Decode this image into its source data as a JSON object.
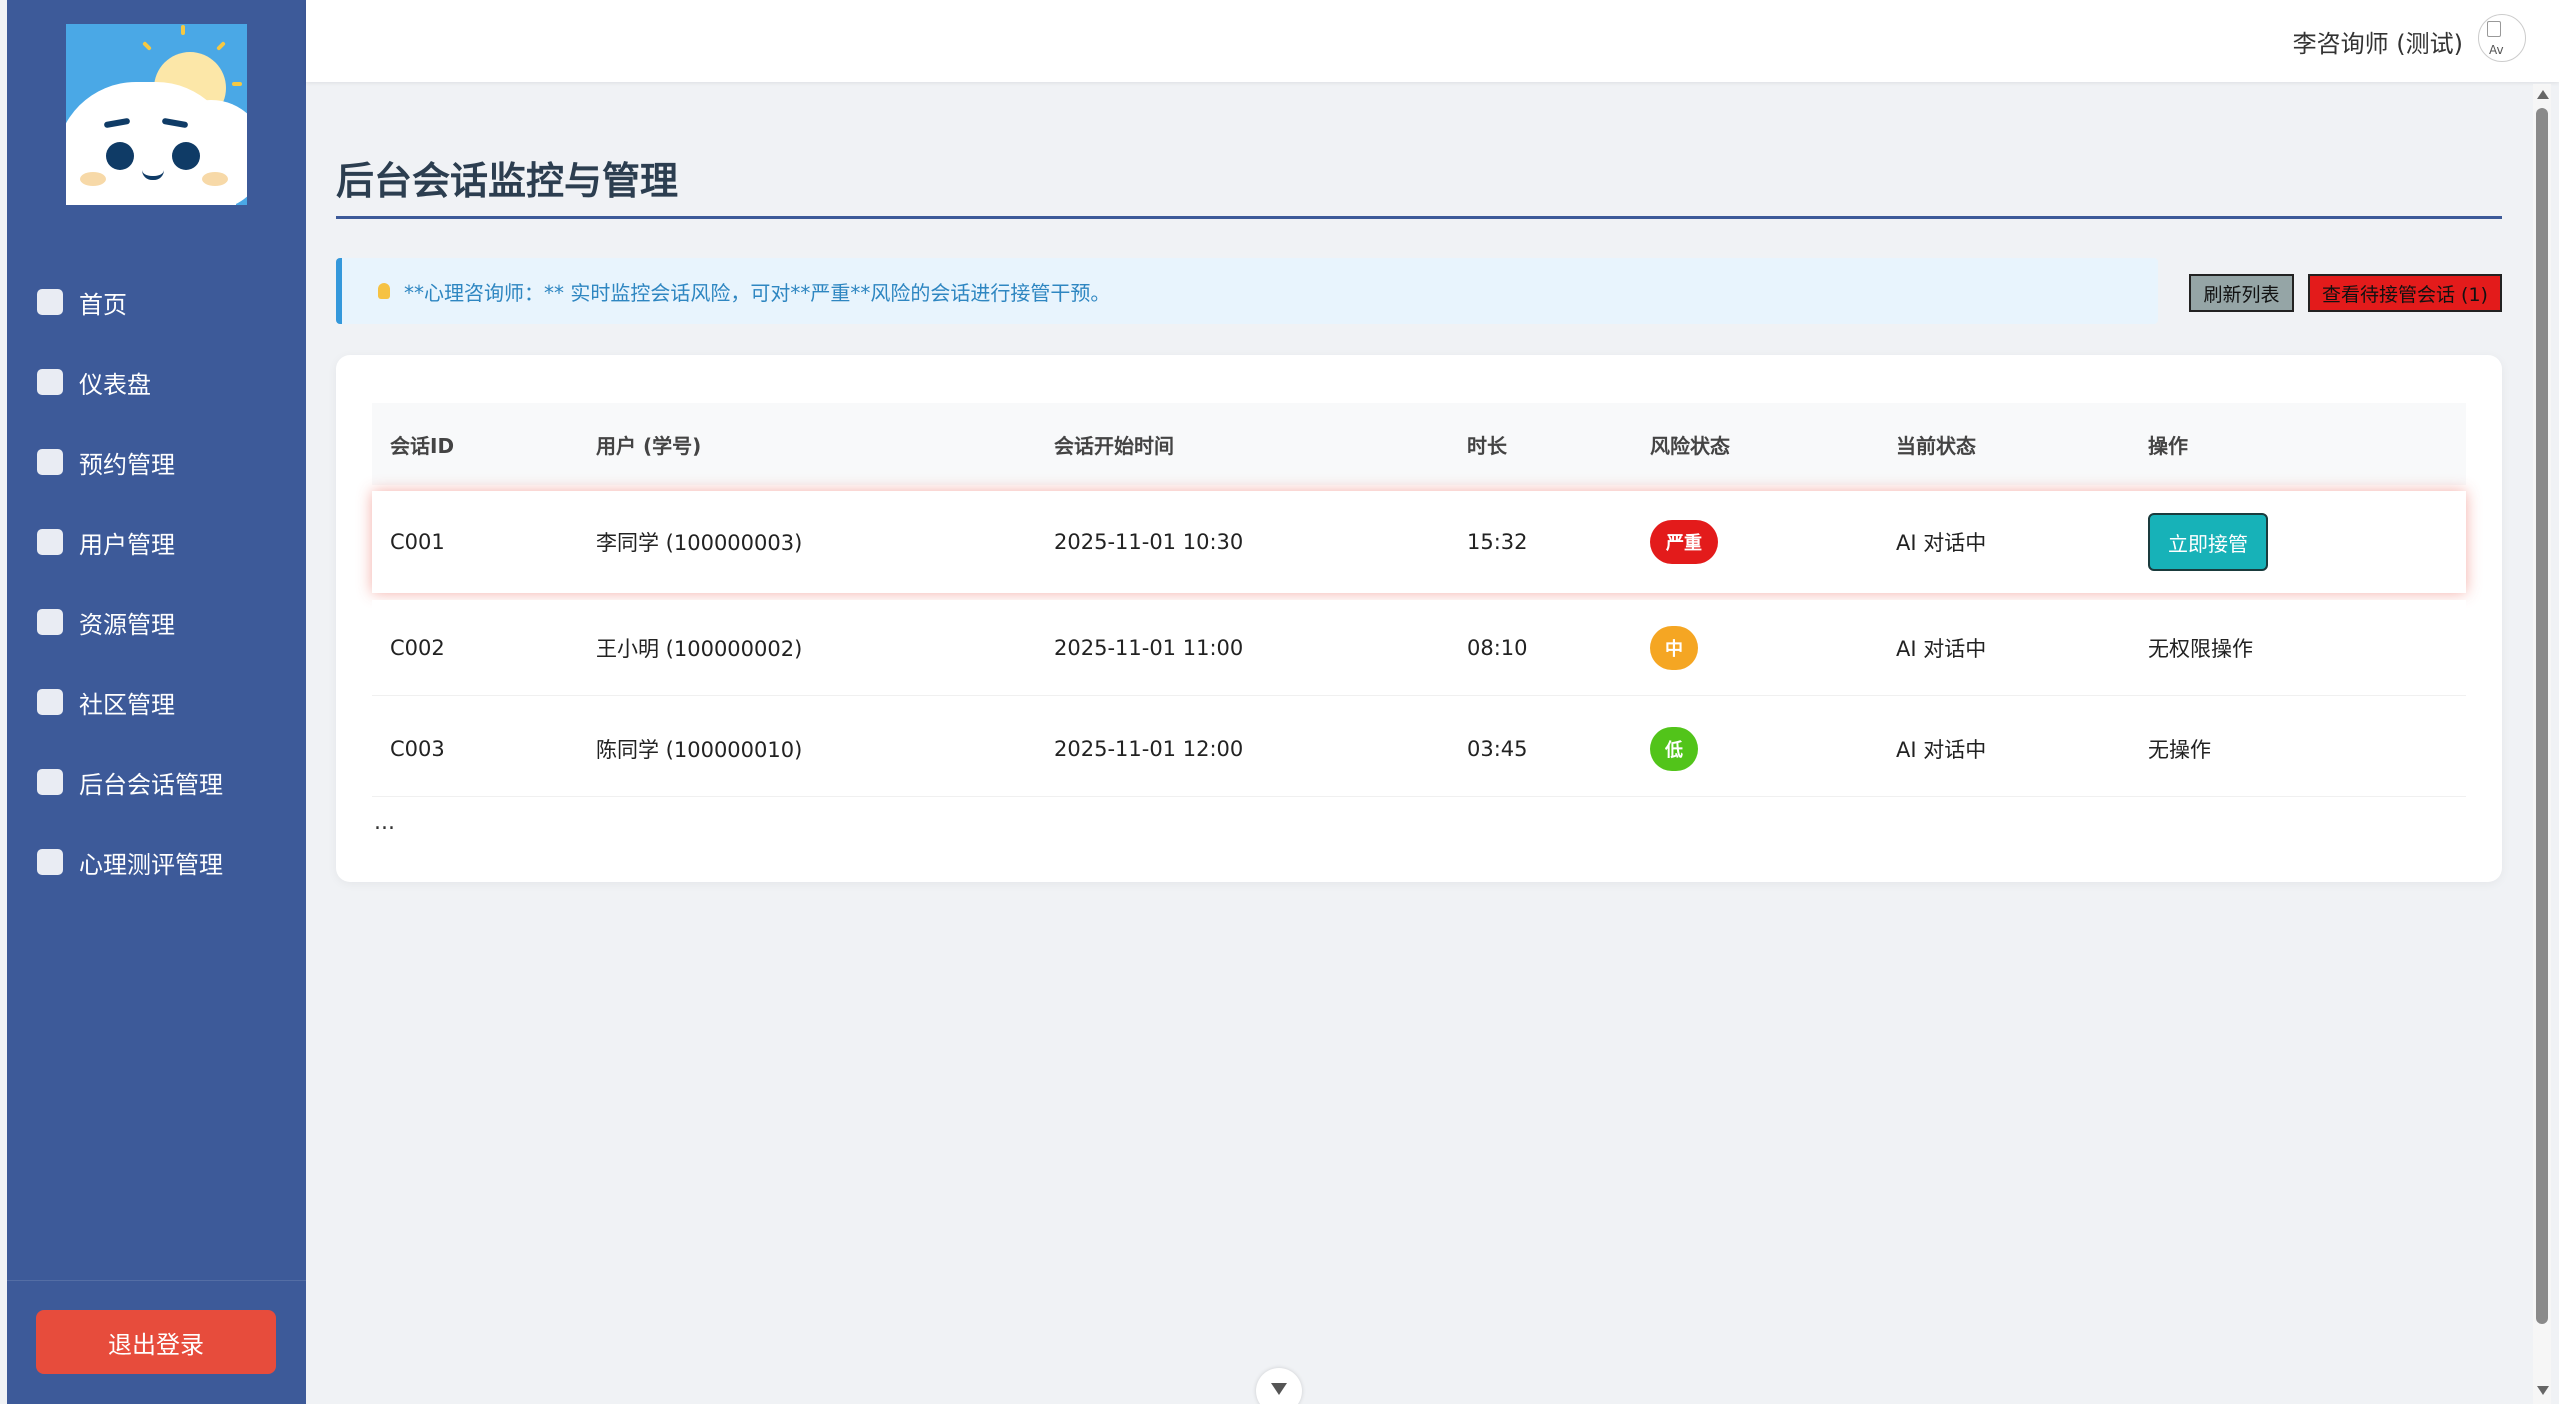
{
  "sidebar": {
    "items": [
      {
        "label": "首页"
      },
      {
        "label": "仪表盘"
      },
      {
        "label": "预约管理"
      },
      {
        "label": "用户管理"
      },
      {
        "label": "资源管理"
      },
      {
        "label": "社区管理"
      },
      {
        "label": "后台会话管理"
      },
      {
        "label": "心理测评管理"
      }
    ],
    "logout_label": "退出登录"
  },
  "header": {
    "user_name": "李咨询师 (测试)",
    "avatar_alt": "Av"
  },
  "main": {
    "title": "后台会话监控与管理",
    "tip": "**心理咨询师：** 实时监控会话风险，可对**严重**风险的会话进行接管干预。",
    "refresh_label": "刷新列表",
    "pending_label": "查看待接管会话 (1)",
    "table": {
      "headers": [
        "会话ID",
        "用户 (学号)",
        "会话开始时间",
        "时长",
        "风险状态",
        "当前状态",
        "操作"
      ],
      "rows": [
        {
          "id": "C001",
          "user": "李同学 (100000003)",
          "start": "2025-11-01 10:30",
          "duration": "15:32",
          "risk": "严重",
          "status": "AI 对话中",
          "action": "立即接管"
        },
        {
          "id": "C002",
          "user": "王小明 (100000002)",
          "start": "2025-11-01 11:00",
          "duration": "08:10",
          "risk": "中",
          "status": "AI 对话中",
          "action": "无权限操作"
        },
        {
          "id": "C003",
          "user": "陈同学 (100000010)",
          "start": "2025-11-01 12:00",
          "duration": "03:45",
          "risk": "低",
          "status": "AI 对话中",
          "action": "无操作"
        }
      ],
      "more": "..."
    }
  },
  "colors": {
    "sidebar": "#3d5a99",
    "risk_high": "#e31b1b",
    "risk_mid": "#f5a623",
    "risk_low": "#52c41a",
    "takeover": "#17b2b8",
    "logout": "#e74c3c"
  }
}
